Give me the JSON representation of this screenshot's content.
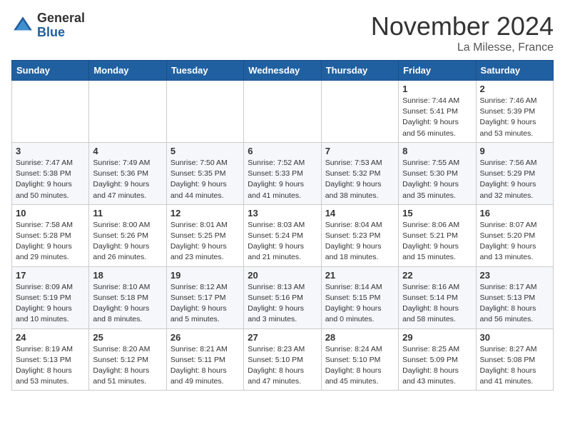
{
  "header": {
    "logo_general": "General",
    "logo_blue": "Blue",
    "month_title": "November 2024",
    "location": "La Milesse, France"
  },
  "weekdays": [
    "Sunday",
    "Monday",
    "Tuesday",
    "Wednesday",
    "Thursday",
    "Friday",
    "Saturday"
  ],
  "weeks": [
    [
      {
        "day": "",
        "info": ""
      },
      {
        "day": "",
        "info": ""
      },
      {
        "day": "",
        "info": ""
      },
      {
        "day": "",
        "info": ""
      },
      {
        "day": "",
        "info": ""
      },
      {
        "day": "1",
        "info": "Sunrise: 7:44 AM\nSunset: 5:41 PM\nDaylight: 9 hours\nand 56 minutes."
      },
      {
        "day": "2",
        "info": "Sunrise: 7:46 AM\nSunset: 5:39 PM\nDaylight: 9 hours\nand 53 minutes."
      }
    ],
    [
      {
        "day": "3",
        "info": "Sunrise: 7:47 AM\nSunset: 5:38 PM\nDaylight: 9 hours\nand 50 minutes."
      },
      {
        "day": "4",
        "info": "Sunrise: 7:49 AM\nSunset: 5:36 PM\nDaylight: 9 hours\nand 47 minutes."
      },
      {
        "day": "5",
        "info": "Sunrise: 7:50 AM\nSunset: 5:35 PM\nDaylight: 9 hours\nand 44 minutes."
      },
      {
        "day": "6",
        "info": "Sunrise: 7:52 AM\nSunset: 5:33 PM\nDaylight: 9 hours\nand 41 minutes."
      },
      {
        "day": "7",
        "info": "Sunrise: 7:53 AM\nSunset: 5:32 PM\nDaylight: 9 hours\nand 38 minutes."
      },
      {
        "day": "8",
        "info": "Sunrise: 7:55 AM\nSunset: 5:30 PM\nDaylight: 9 hours\nand 35 minutes."
      },
      {
        "day": "9",
        "info": "Sunrise: 7:56 AM\nSunset: 5:29 PM\nDaylight: 9 hours\nand 32 minutes."
      }
    ],
    [
      {
        "day": "10",
        "info": "Sunrise: 7:58 AM\nSunset: 5:28 PM\nDaylight: 9 hours\nand 29 minutes."
      },
      {
        "day": "11",
        "info": "Sunrise: 8:00 AM\nSunset: 5:26 PM\nDaylight: 9 hours\nand 26 minutes."
      },
      {
        "day": "12",
        "info": "Sunrise: 8:01 AM\nSunset: 5:25 PM\nDaylight: 9 hours\nand 23 minutes."
      },
      {
        "day": "13",
        "info": "Sunrise: 8:03 AM\nSunset: 5:24 PM\nDaylight: 9 hours\nand 21 minutes."
      },
      {
        "day": "14",
        "info": "Sunrise: 8:04 AM\nSunset: 5:23 PM\nDaylight: 9 hours\nand 18 minutes."
      },
      {
        "day": "15",
        "info": "Sunrise: 8:06 AM\nSunset: 5:21 PM\nDaylight: 9 hours\nand 15 minutes."
      },
      {
        "day": "16",
        "info": "Sunrise: 8:07 AM\nSunset: 5:20 PM\nDaylight: 9 hours\nand 13 minutes."
      }
    ],
    [
      {
        "day": "17",
        "info": "Sunrise: 8:09 AM\nSunset: 5:19 PM\nDaylight: 9 hours\nand 10 minutes."
      },
      {
        "day": "18",
        "info": "Sunrise: 8:10 AM\nSunset: 5:18 PM\nDaylight: 9 hours\nand 8 minutes."
      },
      {
        "day": "19",
        "info": "Sunrise: 8:12 AM\nSunset: 5:17 PM\nDaylight: 9 hours\nand 5 minutes."
      },
      {
        "day": "20",
        "info": "Sunrise: 8:13 AM\nSunset: 5:16 PM\nDaylight: 9 hours\nand 3 minutes."
      },
      {
        "day": "21",
        "info": "Sunrise: 8:14 AM\nSunset: 5:15 PM\nDaylight: 9 hours\nand 0 minutes."
      },
      {
        "day": "22",
        "info": "Sunrise: 8:16 AM\nSunset: 5:14 PM\nDaylight: 8 hours\nand 58 minutes."
      },
      {
        "day": "23",
        "info": "Sunrise: 8:17 AM\nSunset: 5:13 PM\nDaylight: 8 hours\nand 56 minutes."
      }
    ],
    [
      {
        "day": "24",
        "info": "Sunrise: 8:19 AM\nSunset: 5:13 PM\nDaylight: 8 hours\nand 53 minutes."
      },
      {
        "day": "25",
        "info": "Sunrise: 8:20 AM\nSunset: 5:12 PM\nDaylight: 8 hours\nand 51 minutes."
      },
      {
        "day": "26",
        "info": "Sunrise: 8:21 AM\nSunset: 5:11 PM\nDaylight: 8 hours\nand 49 minutes."
      },
      {
        "day": "27",
        "info": "Sunrise: 8:23 AM\nSunset: 5:10 PM\nDaylight: 8 hours\nand 47 minutes."
      },
      {
        "day": "28",
        "info": "Sunrise: 8:24 AM\nSunset: 5:10 PM\nDaylight: 8 hours\nand 45 minutes."
      },
      {
        "day": "29",
        "info": "Sunrise: 8:25 AM\nSunset: 5:09 PM\nDaylight: 8 hours\nand 43 minutes."
      },
      {
        "day": "30",
        "info": "Sunrise: 8:27 AM\nSunset: 5:08 PM\nDaylight: 8 hours\nand 41 minutes."
      }
    ]
  ]
}
